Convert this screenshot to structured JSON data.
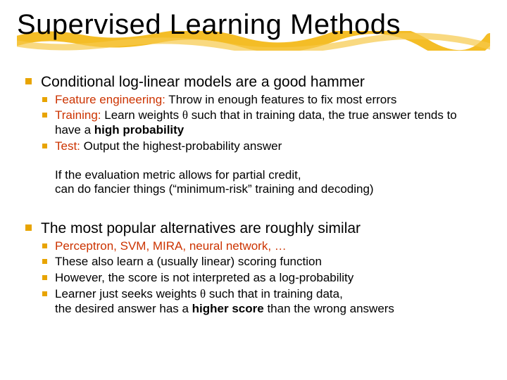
{
  "title": "Supervised Learning Methods",
  "section1": {
    "heading": "Conditional log-linear models are a good hammer",
    "b1_pre": "Feature engineering:",
    "b1_post": " Throw in enough features to fix most errors",
    "b2_pre": "Training:",
    "b2_mid1": " Learn weights ",
    "b2_theta": "θ",
    "b2_mid2": " such that in training data, the true answer tends to have a ",
    "b2_bold": "high probability",
    "b3_pre": "Test:",
    "b3_post": " Output the highest-probability answer",
    "note1": "If the evaluation metric allows for partial credit,",
    "note2": "can do fancier things (“minimum-risk” training and decoding)"
  },
  "section2": {
    "heading": "The most popular alternatives are roughly similar",
    "b1": "Perceptron, SVM, MIRA, neural network, …",
    "b2": "These also learn a (usually linear) scoring function",
    "b3": "However, the score is not interpreted as a log-probability",
    "b4_a": "Learner just seeks weights ",
    "b4_theta": "θ",
    "b4_b": " such that in training data,",
    "b4_c": "the desired answer has a ",
    "b4_bold": "higher score",
    "b4_d": " than the wrong answers"
  }
}
